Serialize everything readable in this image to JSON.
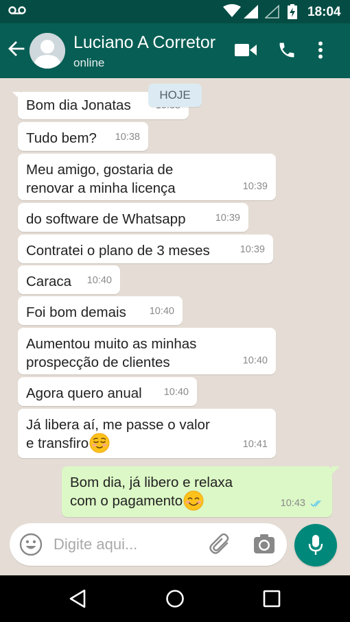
{
  "status_bar": {
    "time": "18:04",
    "icons": [
      "voicemail-icon",
      "wifi-icon",
      "signal-icon",
      "signal-empty-icon",
      "battery-charging-icon"
    ]
  },
  "header": {
    "contact_name": "Luciano A Corretor",
    "contact_status": "online",
    "actions": [
      "video-call-icon",
      "phone-icon",
      "more-vert-icon"
    ],
    "colors": {
      "status_bar": "#054d44",
      "app_bar": "#075e54"
    }
  },
  "chat": {
    "day_label": "HOJE",
    "colors": {
      "background": "#e5ddd5",
      "incoming": "#ffffff",
      "outgoing": "#dcf8c6",
      "read_ticks": "#4fc3f7"
    },
    "messages": [
      {
        "text": "Bom dia Jonatas",
        "time": "10:38",
        "direction": "in"
      },
      {
        "text": "Tudo bem?",
        "time": "10:38",
        "direction": "in"
      },
      {
        "line1": "Meu amigo, gostaria de",
        "line2": "renovar a minha licença",
        "time": "10:39",
        "direction": "in"
      },
      {
        "text": "do software de Whatsapp",
        "time": "10:39",
        "direction": "in"
      },
      {
        "text": "Contratei o plano de 3 meses",
        "time": "10:39",
        "direction": "in"
      },
      {
        "text": "Caraca",
        "time": "10:40",
        "direction": "in"
      },
      {
        "text": "Foi bom demais",
        "time": "10:40",
        "direction": "in"
      },
      {
        "line1": "Aumentou muito as minhas",
        "line2": "prospecção de clientes",
        "time": "10:40",
        "direction": "in"
      },
      {
        "text": "Agora quero anual",
        "time": "10:40",
        "direction": "in"
      },
      {
        "line1": "Já libera aí, me passe o valor",
        "line2": "e transfiro",
        "emoji": "relieved-face-emoji",
        "time": "10:41",
        "direction": "in"
      },
      {
        "line1": "Bom dia, já libero e relaxa",
        "line2": "com o pagamento",
        "emoji": "smiling-face-emoji",
        "time": "10:43",
        "direction": "out",
        "receipt": "double-check-read-icon"
      }
    ]
  },
  "composer": {
    "placeholder": "Digite aqui...",
    "value": "",
    "icons": [
      "emoji-icon",
      "paperclip-icon",
      "camera-icon",
      "microphone-icon"
    ],
    "mic_color": "#00897b"
  },
  "nav_bar": {
    "icons": [
      "nav-back-icon",
      "nav-home-icon",
      "nav-recents-icon"
    ]
  }
}
